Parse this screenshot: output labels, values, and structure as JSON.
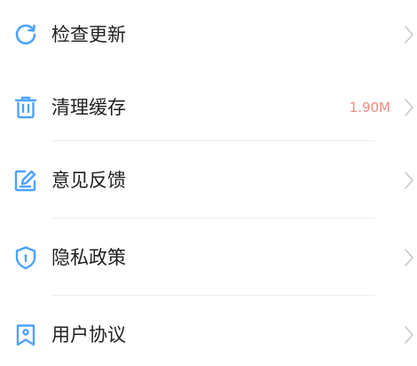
{
  "colors": {
    "icon": "#4da3ff",
    "label": "#1f1f1f",
    "value": "#f08a82",
    "chevron": "#c8c8c8",
    "divider": "#eeeeee"
  },
  "menu": {
    "items": [
      {
        "icon": "refresh-icon",
        "label": "检查更新",
        "value": ""
      },
      {
        "icon": "trash-icon",
        "label": "清理缓存",
        "value": "1.90M"
      },
      {
        "icon": "edit-icon",
        "label": "意见反馈",
        "value": ""
      },
      {
        "icon": "shield-icon",
        "label": "隐私政策",
        "value": ""
      },
      {
        "icon": "bookmark-icon",
        "label": "用户协议",
        "value": ""
      }
    ]
  }
}
